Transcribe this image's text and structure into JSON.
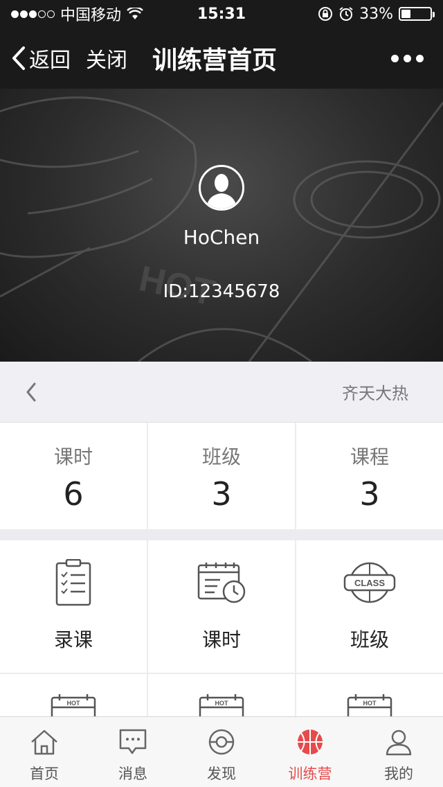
{
  "status_bar": {
    "carrier": "中国移动",
    "time": "15:31",
    "battery_percent": "33%",
    "battery_level": 0.33
  },
  "nav": {
    "back_label": "返回",
    "close_label": "关闭",
    "title": "训练营首页"
  },
  "profile": {
    "name": "HoChen",
    "id": "ID:12345678"
  },
  "sub_bar": {
    "name": "齐天大热"
  },
  "stats": [
    {
      "label": "课时",
      "value": "6"
    },
    {
      "label": "班级",
      "value": "3"
    },
    {
      "label": "课程",
      "value": "3"
    }
  ],
  "grid": {
    "items": [
      {
        "label": "录课",
        "icon": "clipboard-checklist-icon"
      },
      {
        "label": "课时",
        "icon": "calendar-clock-icon"
      },
      {
        "label": "班级",
        "icon": "class-basketball-icon"
      }
    ],
    "partial_badge": "HOT",
    "class_badge": "CLASS"
  },
  "tabs": [
    {
      "label": "首页",
      "icon": "home-icon"
    },
    {
      "label": "消息",
      "icon": "message-icon"
    },
    {
      "label": "发现",
      "icon": "discover-icon"
    },
    {
      "label": "训练营",
      "icon": "basketball-icon",
      "active": true
    },
    {
      "label": "我的",
      "icon": "user-icon"
    }
  ],
  "colors": {
    "accent": "#e54b4b",
    "nav_bg": "#1a1a1a"
  }
}
